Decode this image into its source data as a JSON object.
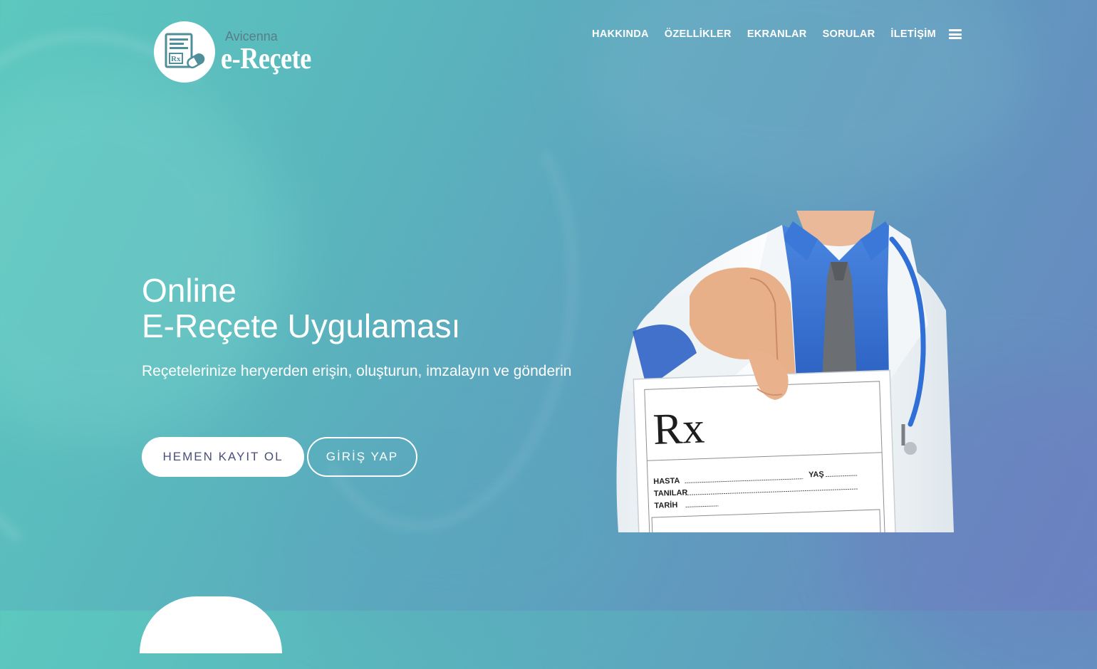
{
  "brand": {
    "top_text": "Avicenna",
    "name": "e-Reçete",
    "logo_label": "Rx"
  },
  "nav": {
    "items": [
      "HAKKINDA",
      "ÖZELLİKLER",
      "EKRANLAR",
      "SORULAR",
      "İLETİŞİM"
    ],
    "menu_icon": "hamburger-icon"
  },
  "hero": {
    "title_line1": "Online",
    "title_line2": "E-Reçete Uygulaması",
    "subtitle": "Reçetelerinize heryerden erişin, oluşturun, imzalayın ve gönderin",
    "primary_button": "HEMEN KAYIT OL",
    "secondary_button": "GİRİŞ YAP"
  },
  "prescription": {
    "rx": "Rx",
    "field_patient": "HASTA",
    "field_age": "YAŞ",
    "field_diagnoses": "TANILAR",
    "field_date": "TARİH"
  },
  "colors": {
    "gradient_start": "#5cc8be",
    "gradient_end": "#6a86c0",
    "button_text": "#4a4f7a",
    "coat_blue": "#2f6fd6"
  }
}
